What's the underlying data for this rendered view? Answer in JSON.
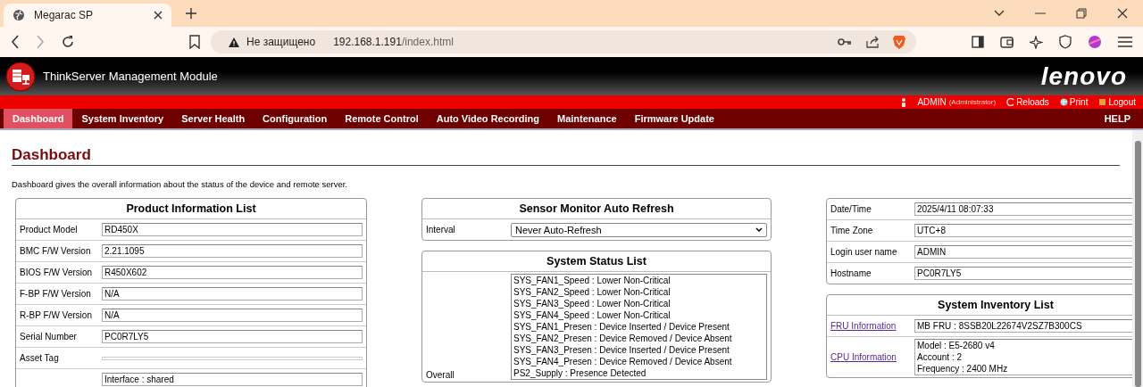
{
  "browser": {
    "tab": {
      "title": "Megarac SP",
      "selected": true
    },
    "address": {
      "security_label": "Не защищено",
      "host": "192.168.1.191",
      "path": "/index.html"
    }
  },
  "header": {
    "title": "ThinkServer Management Module",
    "logo_text": "lenovo"
  },
  "user_bar": {
    "user": "ADMIN",
    "role": "(Administrator)",
    "links": [
      {
        "kind": "reload",
        "label": "Reloads"
      },
      {
        "kind": "print",
        "label": "Print"
      },
      {
        "kind": "logout",
        "label": "Logout"
      }
    ]
  },
  "nav": {
    "items": [
      {
        "label": "Dashboard",
        "selected": true
      },
      {
        "label": "System Inventory",
        "selected": false
      },
      {
        "label": "Server Health",
        "selected": false
      },
      {
        "label": "Configuration",
        "selected": false
      },
      {
        "label": "Remote Control",
        "selected": false
      },
      {
        "label": "Auto Video Recording",
        "selected": false
      },
      {
        "label": "Maintenance",
        "selected": false
      },
      {
        "label": "Firmware Update",
        "selected": false
      }
    ],
    "help": "HELP"
  },
  "page": {
    "heading": "Dashboard",
    "description": "Dashboard gives the overall information about the status of the device and remote server."
  },
  "product_info": {
    "title": "Product Information List",
    "rows": [
      {
        "label": "Product Model",
        "value": [
          "RD450X"
        ]
      },
      {
        "label": "BMC F/W Version",
        "value": [
          "2.21.1095"
        ]
      },
      {
        "label": "BIOS F/W Version",
        "value": [
          "R450X602"
        ]
      },
      {
        "label": "F-BP F/W Version",
        "value": [
          "N/A"
        ]
      },
      {
        "label": "R-BP F/W Version",
        "value": [
          "N/A"
        ]
      },
      {
        "label": "Serial Number",
        "value": [
          "PC0R7LY5"
        ]
      },
      {
        "label": "Asset Tag"
      },
      {
        "value": [
          "Interface : shared"
        ]
      }
    ]
  },
  "sensor_refresh": {
    "title": "Sensor Monitor Auto Refresh",
    "interval_label": "Interval",
    "interval_value": "Never Auto-Refresh"
  },
  "system_status": {
    "title": "System Status List",
    "label": "Overall",
    "lines": [
      "SYS_FAN1_Speed : Lower Non-Critical",
      "SYS_FAN2_Speed : Lower Non-Critical",
      "SYS_FAN3_Speed : Lower Non-Critical",
      "SYS_FAN4_Speed : Lower Non-Critical",
      "SYS_FAN1_Presen : Device Inserted / Device Present",
      "SYS_FAN2_Presen : Device Removed / Device Absent",
      "SYS_FAN3_Presen : Device Inserted / Device Present",
      "SYS_FAN4_Presen : Device Removed / Device Absent",
      "PS2_Supply : Presence Detected"
    ]
  },
  "device_info": {
    "rows": [
      {
        "label": "Date/Time",
        "value": "2025/4/11 08:07:33"
      },
      {
        "label": "Time Zone",
        "value": "UTC+8"
      },
      {
        "label": "Login user name",
        "value": "ADMIN"
      },
      {
        "label": "Hostname",
        "value": "PC0R7LY5"
      }
    ]
  },
  "inventory": {
    "title": "System Inventory List",
    "rows": [
      {
        "link": "FRU Information",
        "lines": [
          "MB FRU : 8SSB20L22674V2SZ7B300CS"
        ]
      },
      {
        "link": "CPU Information",
        "lines": [
          "Model : E5-2680 v4",
          "Account : 2",
          "Frequency : 2400 MHz"
        ]
      }
    ]
  }
}
